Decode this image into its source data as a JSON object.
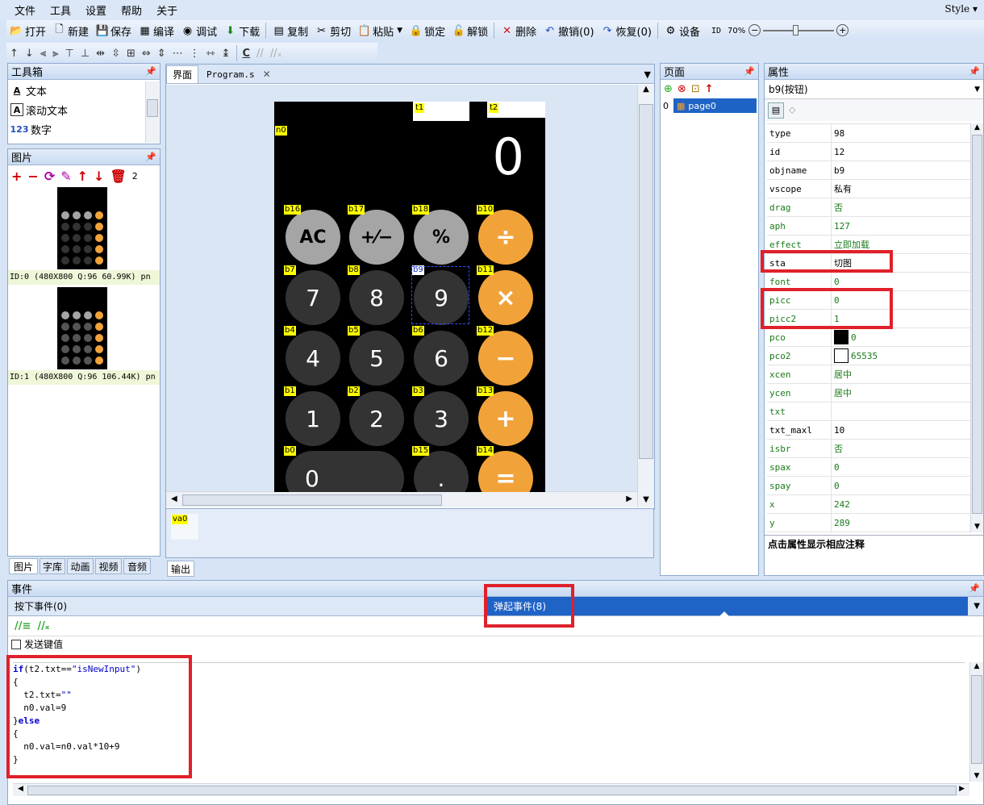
{
  "menu": [
    "文件",
    "工具",
    "设置",
    "帮助",
    "关于"
  ],
  "style_label": "Style",
  "toolbar": {
    "items": [
      {
        "icon": "open-folder-icon",
        "glyph": "📂",
        "label": "打开"
      },
      {
        "icon": "new-file-icon",
        "glyph": "🗋",
        "label": "新建"
      },
      {
        "icon": "save-icon",
        "glyph": "💾",
        "label": "保存"
      },
      {
        "icon": "compile-icon",
        "glyph": "▦",
        "label": "编译"
      },
      {
        "icon": "debug-icon",
        "glyph": "◉",
        "label": "调试"
      },
      {
        "icon": "download-icon",
        "glyph": "⬇",
        "label": "下载"
      },
      {
        "icon": "copy-icon",
        "glyph": "▤",
        "label": "复制"
      },
      {
        "icon": "cut-icon",
        "glyph": "✂",
        "label": "剪切"
      },
      {
        "icon": "paste-icon",
        "glyph": "📋",
        "label": "粘贴"
      },
      {
        "icon": "lock-icon",
        "glyph": "🔒",
        "label": "锁定"
      },
      {
        "icon": "unlock-icon",
        "glyph": "🔓",
        "label": "解锁"
      },
      {
        "icon": "delete-icon",
        "glyph": "✕",
        "label": "删除"
      },
      {
        "icon": "undo-icon",
        "glyph": "↶",
        "label": "撤销(0)"
      },
      {
        "icon": "redo-icon",
        "glyph": "↷",
        "label": "恢复(0)"
      },
      {
        "icon": "settings-gear-icon",
        "glyph": "⚙",
        "label": "设备"
      }
    ],
    "id_label": "ID",
    "zoom": "70%",
    "zoom_level": 0.45
  },
  "align_toolbar": {
    "c_label": "C"
  },
  "toolbox": {
    "title": "工具箱",
    "items": [
      {
        "icon": "A",
        "label": "文本"
      },
      {
        "icon": "A",
        "label": "滚动文本"
      },
      {
        "icon": "123",
        "label": "数字"
      }
    ]
  },
  "pictures": {
    "title": "图片",
    "count": "2",
    "items": [
      {
        "caption": "ID:0  (480X800 Q:96 60.99K) pn"
      },
      {
        "caption": "ID:1  (480X800 Q:96 106.44K) pn"
      }
    ]
  },
  "left_tabs": [
    "图片",
    "字库",
    "动画",
    "视频",
    "音频"
  ],
  "editor": {
    "tabs": [
      "界面",
      "Program.s"
    ],
    "display": "0",
    "labels": {
      "t1": "t1",
      "t2": "t2",
      "n0": "n0"
    },
    "buttons": [
      {
        "tag": "b16",
        "text": "AC",
        "style": "g1"
      },
      {
        "tag": "b17",
        "text": "+⁄−",
        "style": "g1"
      },
      {
        "tag": "b18",
        "text": "%",
        "style": "g1"
      },
      {
        "tag": "b10",
        "text": "÷",
        "style": "g3"
      },
      {
        "tag": "b7",
        "text": "7",
        "style": "g2"
      },
      {
        "tag": "b8",
        "text": "8",
        "style": "g2"
      },
      {
        "tag": "b9",
        "text": "9",
        "style": "g2"
      },
      {
        "tag": "b11",
        "text": "×",
        "style": "g3"
      },
      {
        "tag": "b4",
        "text": "4",
        "style": "g2"
      },
      {
        "tag": "b5",
        "text": "5",
        "style": "g2"
      },
      {
        "tag": "b6",
        "text": "6",
        "style": "g2"
      },
      {
        "tag": "b12",
        "text": "−",
        "style": "g3"
      },
      {
        "tag": "b1",
        "text": "1",
        "style": "g2"
      },
      {
        "tag": "b2",
        "text": "2",
        "style": "g2"
      },
      {
        "tag": "b3",
        "text": "3",
        "style": "g2"
      },
      {
        "tag": "b13",
        "text": "+",
        "style": "g3"
      },
      {
        "tag": "b0",
        "text": "0",
        "style": "g2"
      },
      {
        "tag": "b15",
        "text": ".",
        "style": "g2"
      },
      {
        "tag": "b14",
        "text": "=",
        "style": "g3"
      }
    ],
    "var_label": "va0",
    "output_tab": "输出"
  },
  "pages": {
    "title": "页面",
    "items": [
      {
        "idx": "0",
        "name": "page0"
      }
    ]
  },
  "props": {
    "title": "属性",
    "selected": "b9(按钮)",
    "hint": "点击属性显示相应注释",
    "rows": [
      {
        "k": "type",
        "v": "98",
        "c": ""
      },
      {
        "k": "id",
        "v": "12",
        "c": ""
      },
      {
        "k": "objname",
        "v": "b9",
        "c": ""
      },
      {
        "k": "vscope",
        "v": "私有",
        "c": ""
      },
      {
        "k": "drag",
        "v": "否",
        "c": "green"
      },
      {
        "k": "aph",
        "v": "127",
        "c": "green"
      },
      {
        "k": "effect",
        "v": "立即加载",
        "c": "green"
      },
      {
        "k": "sta",
        "v": "切图",
        "c": ""
      },
      {
        "k": "font",
        "v": "0",
        "c": "green"
      },
      {
        "k": "picc",
        "v": "0",
        "c": "green"
      },
      {
        "k": "picc2",
        "v": "1",
        "c": "green"
      },
      {
        "k": "pco",
        "v": "0",
        "c": "green",
        "sw": "#000000"
      },
      {
        "k": "pco2",
        "v": "65535",
        "c": "green",
        "sw": "#ffffff"
      },
      {
        "k": "xcen",
        "v": "居中",
        "c": "green"
      },
      {
        "k": "ycen",
        "v": "居中",
        "c": "green"
      },
      {
        "k": "txt",
        "v": "",
        "c": "green"
      },
      {
        "k": "txt_maxl",
        "v": "10",
        "c": ""
      },
      {
        "k": "isbr",
        "v": "否",
        "c": "green"
      },
      {
        "k": "spax",
        "v": "0",
        "c": "green"
      },
      {
        "k": "spay",
        "v": "0",
        "c": "green"
      },
      {
        "k": "x",
        "v": "242",
        "c": "green"
      },
      {
        "k": "y",
        "v": "289",
        "c": "green"
      }
    ]
  },
  "events": {
    "title": "事件",
    "press_tab": "按下事件(0)",
    "release_tab": "弹起事件(8)",
    "send_key": "发送键值",
    "code": [
      [
        {
          "t": "if",
          "c": "kw"
        },
        {
          "t": "(t2.txt==",
          "c": ""
        },
        {
          "t": "\"isNewInput\"",
          "c": "str"
        },
        {
          "t": ")",
          "c": ""
        }
      ],
      [
        {
          "t": "{",
          "c": ""
        }
      ],
      [
        {
          "t": "  t2.txt=",
          "c": ""
        },
        {
          "t": "\"\"",
          "c": "str"
        }
      ],
      [
        {
          "t": "  n0.val=9",
          "c": ""
        }
      ],
      [
        {
          "t": "}",
          "c": ""
        },
        {
          "t": "else",
          "c": "kw"
        }
      ],
      [
        {
          "t": "{",
          "c": ""
        }
      ],
      [
        {
          "t": "  n0.val=n0.val*10+9",
          "c": ""
        }
      ],
      [
        {
          "t": "}",
          "c": ""
        }
      ]
    ]
  },
  "colors": {
    "highlight": "#e0202a",
    "accent": "#1f63c6",
    "orange": "#f1a33a"
  }
}
